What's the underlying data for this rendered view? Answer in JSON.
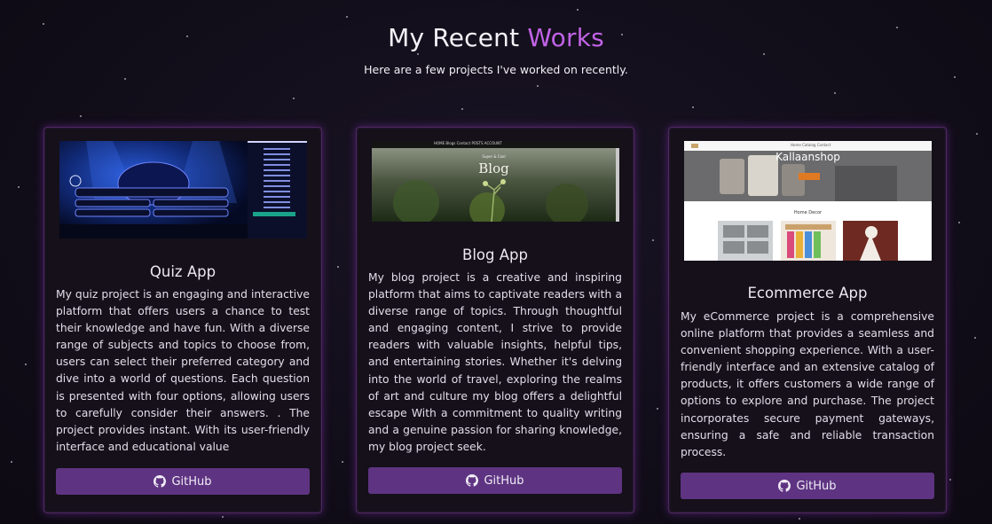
{
  "header": {
    "title_main": "My Recent ",
    "title_accent": "Works",
    "subtitle": "Here are a few projects I've worked on recently."
  },
  "colors": {
    "accent": "#c063e6",
    "button": "#5e3482",
    "card_glow": "#7d32aa"
  },
  "projects": [
    {
      "title": "Quiz App",
      "description": "My quiz project is an engaging and interactive platform that offers users a chance to test their knowledge and have fun. With a diverse range of subjects and topics to choose from, users can select their preferred category and dive into a world of questions. Each question is presented with four options, allowing users to carefully consider their answers. . The project provides instant. With its user-friendly interface and educational value",
      "button_label": "GitHub",
      "button_icon": "github-icon"
    },
    {
      "title": "Blog App",
      "description": "My blog project is a creative and inspiring platform that aims to captivate readers with a diverse range of topics. Through thoughtful and engaging content, I strive to provide readers with valuable insights, helpful tips, and entertaining stories. Whether it's delving into the world of travel, exploring the realms of art and culture my blog offers a delightful escape With a commitment to quality writing and a genuine passion for sharing knowledge, my blog project seek.",
      "button_label": "GitHub",
      "button_icon": "github-icon",
      "screenshot": {
        "hero_small": "Super & Cool",
        "hero_title": "Blog",
        "nav": "HOME  Blogs  Contact  POSTS  ACCOUNT"
      }
    },
    {
      "title": "Ecommerce App",
      "description": "My eCommerce project is a comprehensive online platform that provides a seamless and convenient shopping experience. With a user-friendly interface and an extensive catalog of products, it offers customers a wide range of options to explore and purchase. The project incorporates secure payment gateways, ensuring a safe and reliable transaction process.",
      "button_label": "GitHub",
      "button_icon": "github-icon",
      "screenshot": {
        "brand": "Kallaanshop",
        "section": "Home Decor",
        "nav": "Home  Catalog  Contact"
      }
    }
  ]
}
